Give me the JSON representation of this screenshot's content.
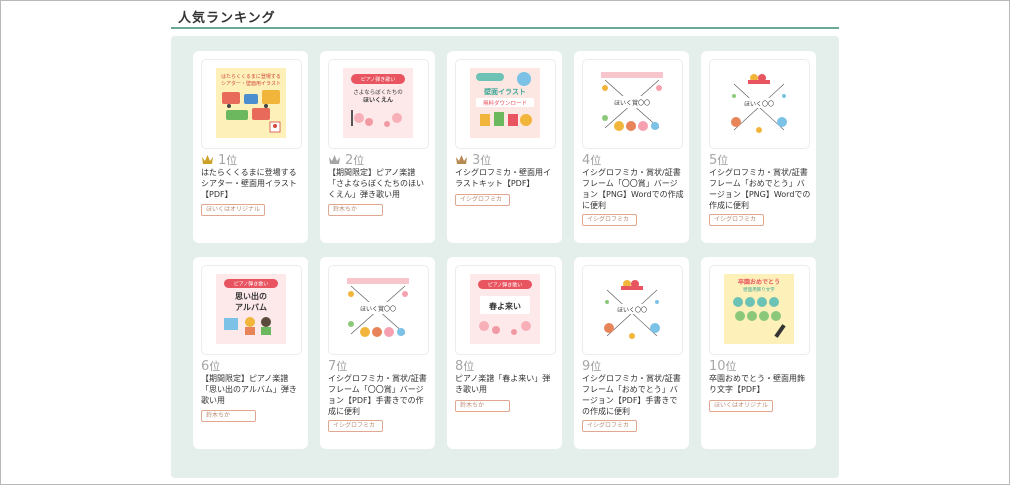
{
  "section": {
    "title": "人気ランキング"
  },
  "rank_suffix": "位",
  "colors": {
    "accent": "#6aa897",
    "panel_bg": "#e4efec",
    "badge_border": "#e0a890",
    "crown_gold": "#c9a227"
  },
  "items": [
    {
      "rank": "1",
      "title": "はたらくくるまに登場するシアター・壁面用イラスト【PDF】",
      "tag": "ほいくはオリジナル",
      "thumb": {
        "l1": "はたらくくるまに登場する",
        "l2": "シアター・壁面用イラスト"
      }
    },
    {
      "rank": "2",
      "title": "【期間限定】ピアノ楽譜「さよならぼくたちのほいくえん」弾き歌い用",
      "tag": "鈴木ちか",
      "thumb": {
        "l1": "ピアノ弾き歌い",
        "l2": "さよならぼくたちの",
        "l3": "ほいくえん"
      }
    },
    {
      "rank": "3",
      "title": "イシグロフミカ・壁面用イラストキット【PDF】",
      "tag": "イシグロフミカ",
      "thumb": {
        "l1": "壁面イラスト",
        "l2": "無料ダウンロード"
      }
    },
    {
      "rank": "4",
      "title": "イシグロフミカ・賞状/証書フレーム「〇〇賞」バージョン【PNG】Wordでの作成に便利",
      "tag": "イシグロフミカ",
      "thumb": {
        "l1": "ほいく賞〇〇"
      }
    },
    {
      "rank": "5",
      "title": "イシグロフミカ・賞状/証書フレーム「おめでとう」バージョン【PNG】Wordでの作成に便利",
      "tag": "イシグロフミカ",
      "thumb": {
        "l1": "ほいく〇〇"
      }
    },
    {
      "rank": "6",
      "title": "【期間限定】ピアノ楽譜「思い出のアルバム」弾き歌い用",
      "tag": "鈴木ちか",
      "thumb": {
        "l1": "ピアノ弾き歌い",
        "l2": "思い出の",
        "l3": "アルバム"
      }
    },
    {
      "rank": "7",
      "title": "イシグロフミカ・賞状/証書フレーム「〇〇賞」バージョン【PDF】手書きでの作成に便利",
      "tag": "イシグロフミカ",
      "thumb": {
        "l1": "ほいく賞〇〇"
      }
    },
    {
      "rank": "8",
      "title": "ピアノ楽譜「春よ来い」弾き歌い用",
      "tag": "鈴木ちか",
      "thumb": {
        "l1": "ピアノ弾き歌い",
        "l2": "春よ来い"
      }
    },
    {
      "rank": "9",
      "title": "イシグロフミカ・賞状/証書フレーム「おめでとう」バージョン【PDF】手書きでの作成に便利",
      "tag": "イシグロフミカ",
      "thumb": {
        "l1": "ほいく〇〇"
      }
    },
    {
      "rank": "10",
      "title": "卒園おめでとう・壁面用飾り文字【PDF】",
      "tag": "ほいくはオリジナル",
      "thumb": {
        "l1": "卒園おめでとう",
        "l2": "壁面用飾り文字"
      }
    }
  ]
}
